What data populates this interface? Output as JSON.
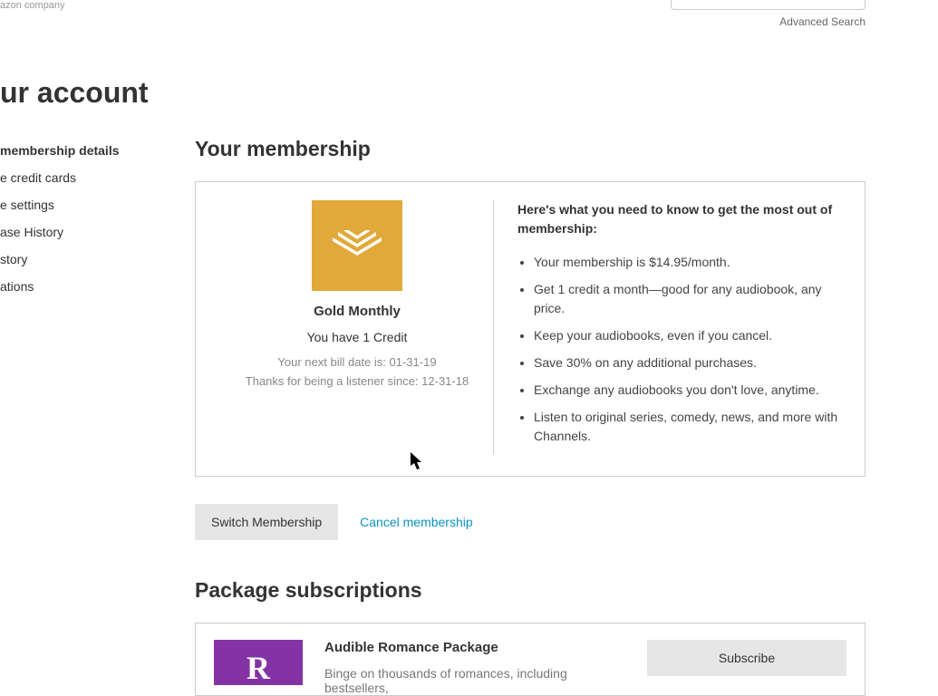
{
  "header": {
    "tagline": "azon company",
    "advanced_search": "Advanced Search"
  },
  "page_title": "ur account",
  "sidebar": {
    "items": [
      {
        "label": "membership details",
        "active": true
      },
      {
        "label": "e credit cards"
      },
      {
        "label": "e settings"
      },
      {
        "label": "ase History"
      },
      {
        "label": "story"
      },
      {
        "label": "ations"
      }
    ]
  },
  "membership": {
    "section_title": "Your membership",
    "plan_name": "Gold Monthly",
    "credit_line": "You have 1 Credit",
    "next_bill": "Your next bill date is: 01-31-19",
    "listener_since": "Thanks for being a listener since: 12-31-18",
    "intro": "Here's what you need to know to get the most out of membership:",
    "bullets": [
      "Your membership is $14.95/month.",
      "Get 1 credit a month—good for any audiobook, any price.",
      "Keep your audiobooks, even if you cancel.",
      "Save 30% on any additional purchases.",
      "Exchange any audiobooks you don't love, anytime.",
      "Listen to original series, comedy, news, and more with Channels."
    ],
    "switch_label": "Switch Membership",
    "cancel_label": "Cancel membership"
  },
  "packages": {
    "section_title": "Package subscriptions",
    "items": [
      {
        "name": "Audible Romance Package",
        "desc": "Binge on thousands of romances, including bestsellers,",
        "cta": "Subscribe",
        "glyph": "R"
      }
    ]
  }
}
